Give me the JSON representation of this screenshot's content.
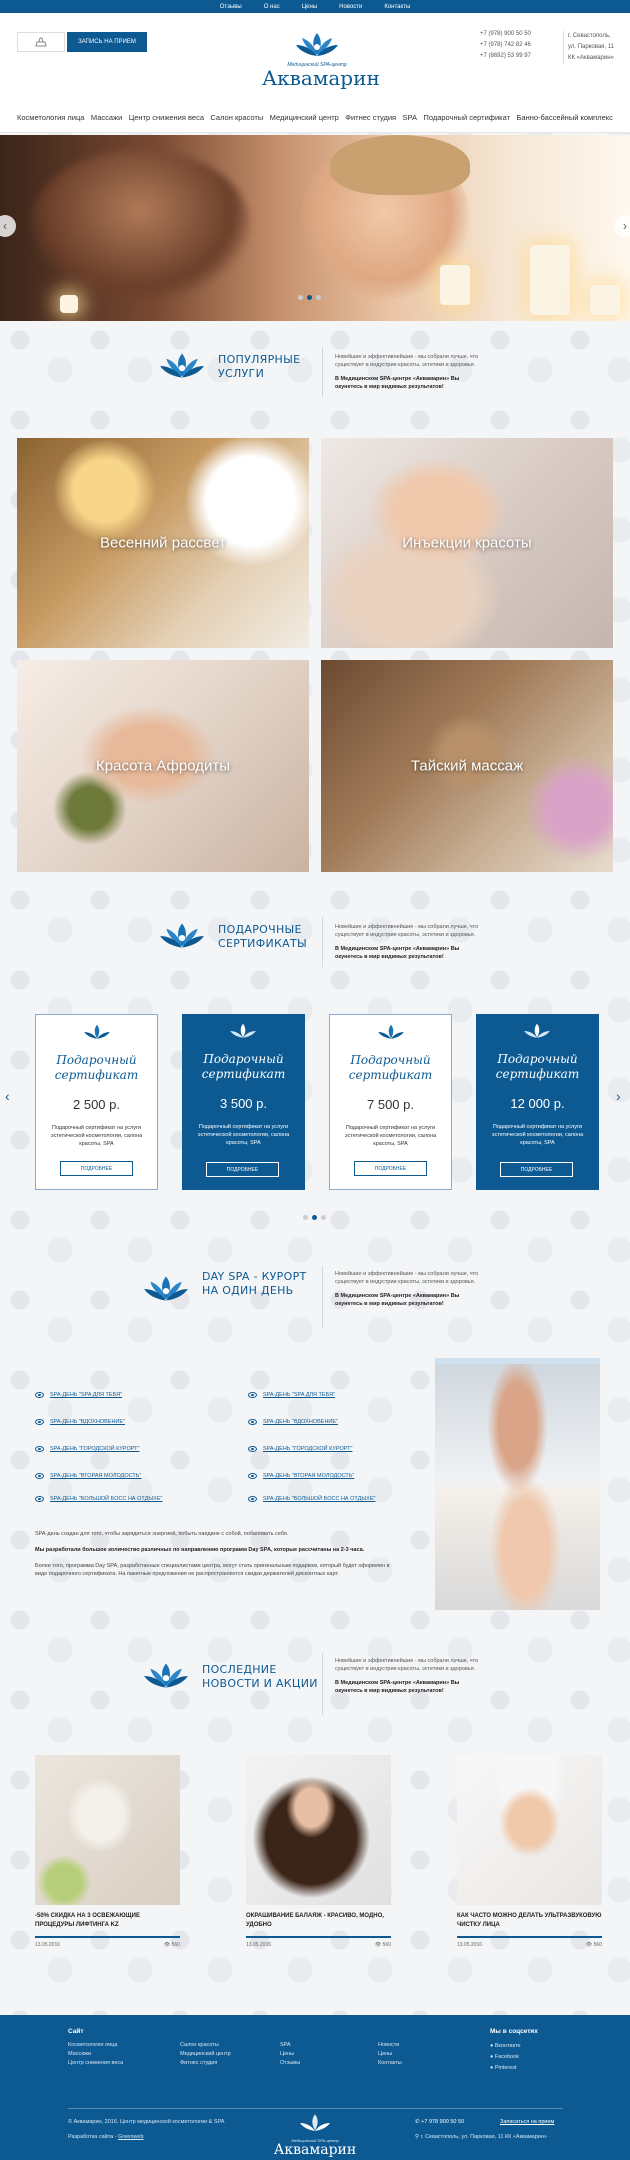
{
  "topnav": [
    "Отзывы",
    "О нас",
    "Цены",
    "Новости",
    "Контакты"
  ],
  "header": {
    "appointment": "Запись на прием",
    "logo_sub": "Медицинский SPA-центр",
    "logo_name": "Аквамарин",
    "phones": [
      "+7 (978) 900 50 50",
      "+7 (978) 742 82 46",
      "+7 (8692) 53 99 97"
    ],
    "address": [
      "г. Севастополь,",
      "ул. Парковая, 11",
      "КК «Аквамарин»"
    ]
  },
  "mainnav": [
    "Косметология лица",
    "Массажи",
    "Центр снижения веса",
    "Салон красоты",
    "Медицинский центр",
    "Фитнес студия",
    "SPA",
    "Подарочный сертификат",
    "Банно-бассейный комплекс"
  ],
  "hero": {
    "prev": "‹",
    "next": "›"
  },
  "services": {
    "title_1": "Популярные",
    "title_2": "услуги",
    "desc": "Новейшие и эффективнейшие - мы собрали лучше, что существует в индустрии красоты, эстетики и здоровья.",
    "desc_bold": "В Медицинском SPA-центре «Аквамарин» Вы окунетесь в мир видимых результатов!",
    "items": [
      "Весенний рассвет",
      "Инъекции красоты",
      "Красота Афродиты",
      "Тайский массаж"
    ]
  },
  "certs": {
    "title_1": "Подарочные",
    "title_2": "сертификаты",
    "desc": "Новейшие и эффективнейшие - мы собрали лучше, что существует в индустрии красоты, эстетики и здоровья.",
    "desc_bold": "В Медицинском SPA-центре «Аквамарин» Вы окунетесь в мир видимых результатов!",
    "card_title_1": "Подарочный",
    "card_title_2": "сертификат",
    "card_desc": "Подарочный сертификат на услуги эстетической косметологии, салона красоты, SPA",
    "more": "Подробнее",
    "prices": [
      "2 500 р.",
      "3 500 р.",
      "7 500 р.",
      "12 000 р."
    ]
  },
  "dayspa": {
    "title_1": "Day SPA - курорт",
    "title_2": "на один день",
    "desc": "Новейшие и эффективнейшие - мы собрали лучше, что существует в индустрии красоты, эстетики и здоровья.",
    "desc_bold": "В Медицинском SPA-центре «Аквамарин» Вы окунетесь в мир видимых результатов!",
    "links_left": [
      "SPA-ДЕНЬ \"SPA ДЛЯ ТЕБЯ\"",
      "SPA-ДЕНЬ \"ВДОХНОВЕНИЕ\"",
      "SPA-ДЕНЬ \"ГОРОДСКОЙ КУРОРТ\"",
      "SPA-ДЕНЬ \"ВТОРАЯ МОЛОДОСТЬ\"",
      "SPA-ДЕНЬ \"БОЛЬШОЙ БОСС НА ОТДЫХЕ\""
    ],
    "links_right": [
      "SPA-ДЕНЬ \"SPA ДЛЯ ТЕБЯ\"",
      "SPA-ДЕНЬ \"ВДОХНОВЕНИЕ\"",
      "SPA-ДЕНЬ \"ГОРОДСКОЙ КУРОРТ\"",
      "SPA-ДЕНЬ \"ВТОРАЯ МОЛОДОСТЬ\"",
      "SPA-ДЕНЬ \"БОЛЬШОЙ БОСС НА ОТДЫХЕ\""
    ],
    "p1": "SPA-день создан для того, чтобы зарядиться энергией, побыть наедине с собой, побаловать себя.",
    "p2": "Мы разработали большое количество различных по направлению программ Day SPA, которые рассчитаны на 2-3 часа.",
    "p3": "Более того, программа Day SPA, разработанные специалистами центра, могут стать оригинальным подарком, который будет оформлен в виде подарочного сертификата. На пакетные предложения не распространяются скидки держателей дисконтных карт."
  },
  "news": {
    "title_1": "Последние",
    "title_2": "новости и акции",
    "desc": "Новейшие и эффективнейшие - мы собрали лучше, что существует в индустрии красоты, эстетики и здоровья.",
    "desc_bold": "В Медицинском SPA-центре «Аквамарин» Вы окунетесь в мир видимых результатов!",
    "items": [
      {
        "title": "-50% скидка на 3 освежающие процедуры лифтинга KZ",
        "date": "13.05.2016",
        "views": "560"
      },
      {
        "title": "Окрашивание балаяж - красиво, модно, удобно",
        "date": "13.05.2016",
        "views": "560"
      },
      {
        "title": "Как часто можно делать ультразвуковую чистку лица",
        "date": "13.05.2016",
        "views": "560"
      }
    ]
  },
  "footer": {
    "site": "Сайт",
    "col1": [
      "Косметология лица",
      "Массажи",
      "Центр снижения веса"
    ],
    "col2": [
      "Салон красоты",
      "Медицинский центр",
      "Фитнес студия"
    ],
    "col3": [
      "SPA",
      "Цены",
      "Отзывы"
    ],
    "col4": [
      "Новости",
      "Цены",
      "Контакты"
    ],
    "social_title": "Мы в соцсетях",
    "social": [
      "Вконтакте",
      "Facebook",
      "Pinterest"
    ],
    "copy": "© Аквамарин, 2016. Центр медицинской косметологии & SPA",
    "dev_label": "Разработка сайта -",
    "dev": "Greenweb",
    "logo_sub": "Медицинский SPA-центр",
    "logo_name": "Аквамарин",
    "phone": "+7 978 900 50 50",
    "appt": "Записаться на прием",
    "address": "г. Севастополь, ул. Парковая, 11 КК «Аквамарин»"
  },
  "colors": {
    "brand": "#0d5a93"
  }
}
